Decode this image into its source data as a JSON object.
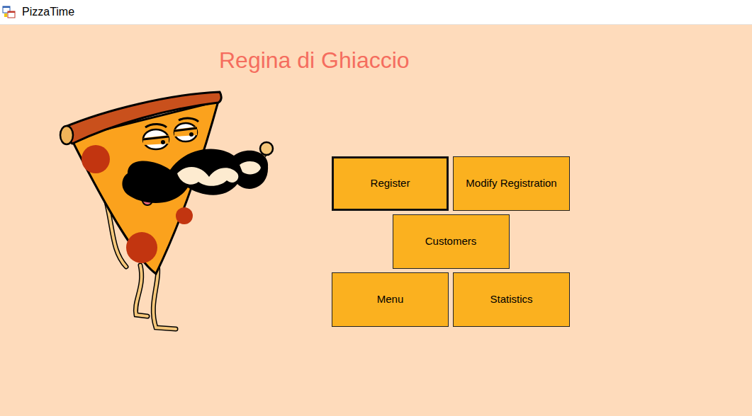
{
  "window": {
    "title": "PizzaTime"
  },
  "heading": "Regina di Ghiaccio",
  "button_rows": [
    [
      {
        "label": "Register",
        "selected": true
      },
      {
        "label": "Modify Registration",
        "selected": false
      }
    ],
    [
      {
        "label": "Customers",
        "selected": false
      }
    ],
    [
      {
        "label": "Menu",
        "selected": false
      },
      {
        "label": "Statistics",
        "selected": false
      }
    ]
  ]
}
